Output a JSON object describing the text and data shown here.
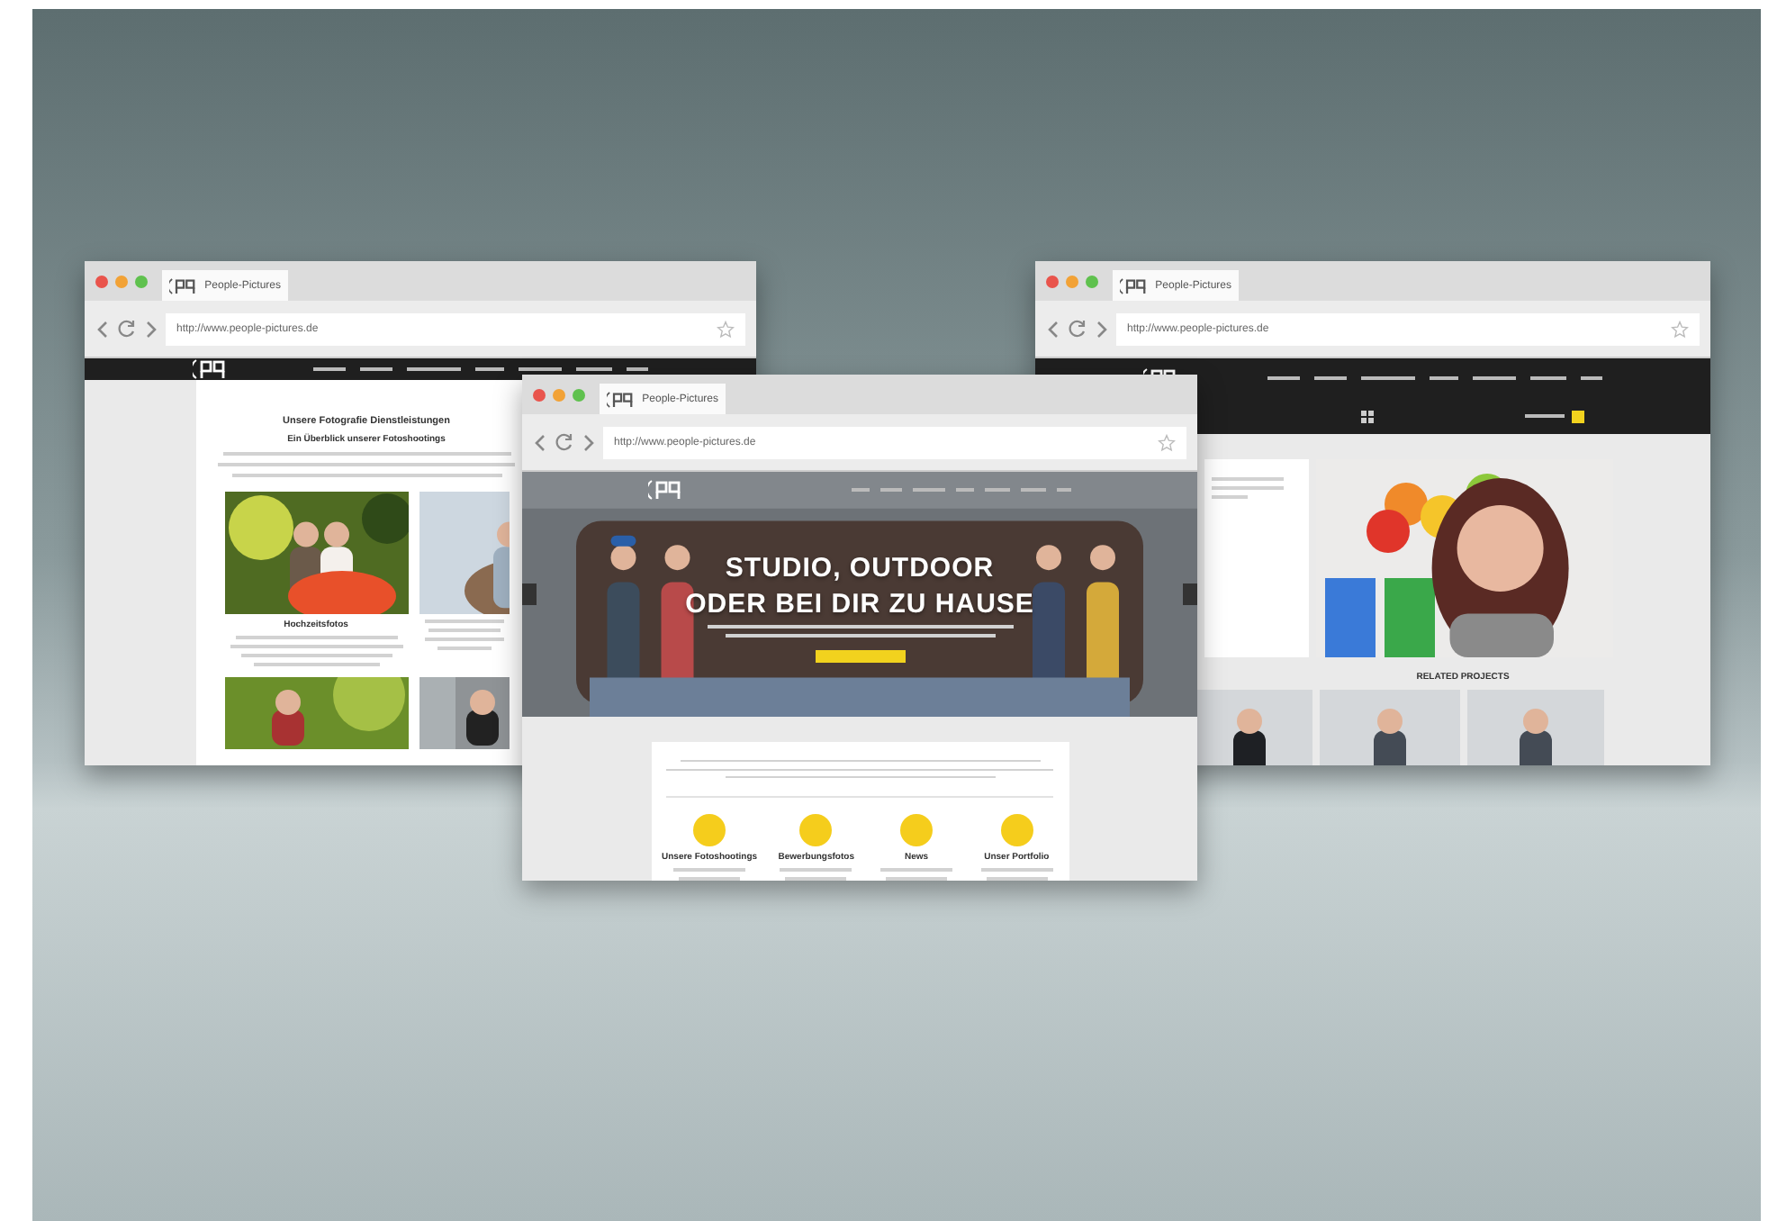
{
  "windows": [
    {
      "kind": "services",
      "tab_title": "People-Pictures",
      "url": "http://www.people-pictures.de",
      "heading": "Unsere Fotografie Dienstleistungen",
      "subheading": "Ein Überblick unserer Fotoshootings",
      "captions": [
        "Hochzeitsfotos"
      ]
    },
    {
      "kind": "project",
      "tab_title": "People-Pictures",
      "url": "http://www.people-pictures.de",
      "related_heading": "RELATED PROJECTS"
    },
    {
      "kind": "hero",
      "tab_title": "People-Pictures",
      "url": "http://www.people-pictures.de",
      "hero_lines": [
        "STUDIO, OUTDOOR",
        "ODER BEI DIR ZU HAUSE"
      ],
      "features": [
        {
          "title": "Unsere Fotoshootings"
        },
        {
          "title": "Bewerbungsfotos"
        },
        {
          "title": "News"
        },
        {
          "title": "Unser Portfolio"
        }
      ]
    }
  ]
}
